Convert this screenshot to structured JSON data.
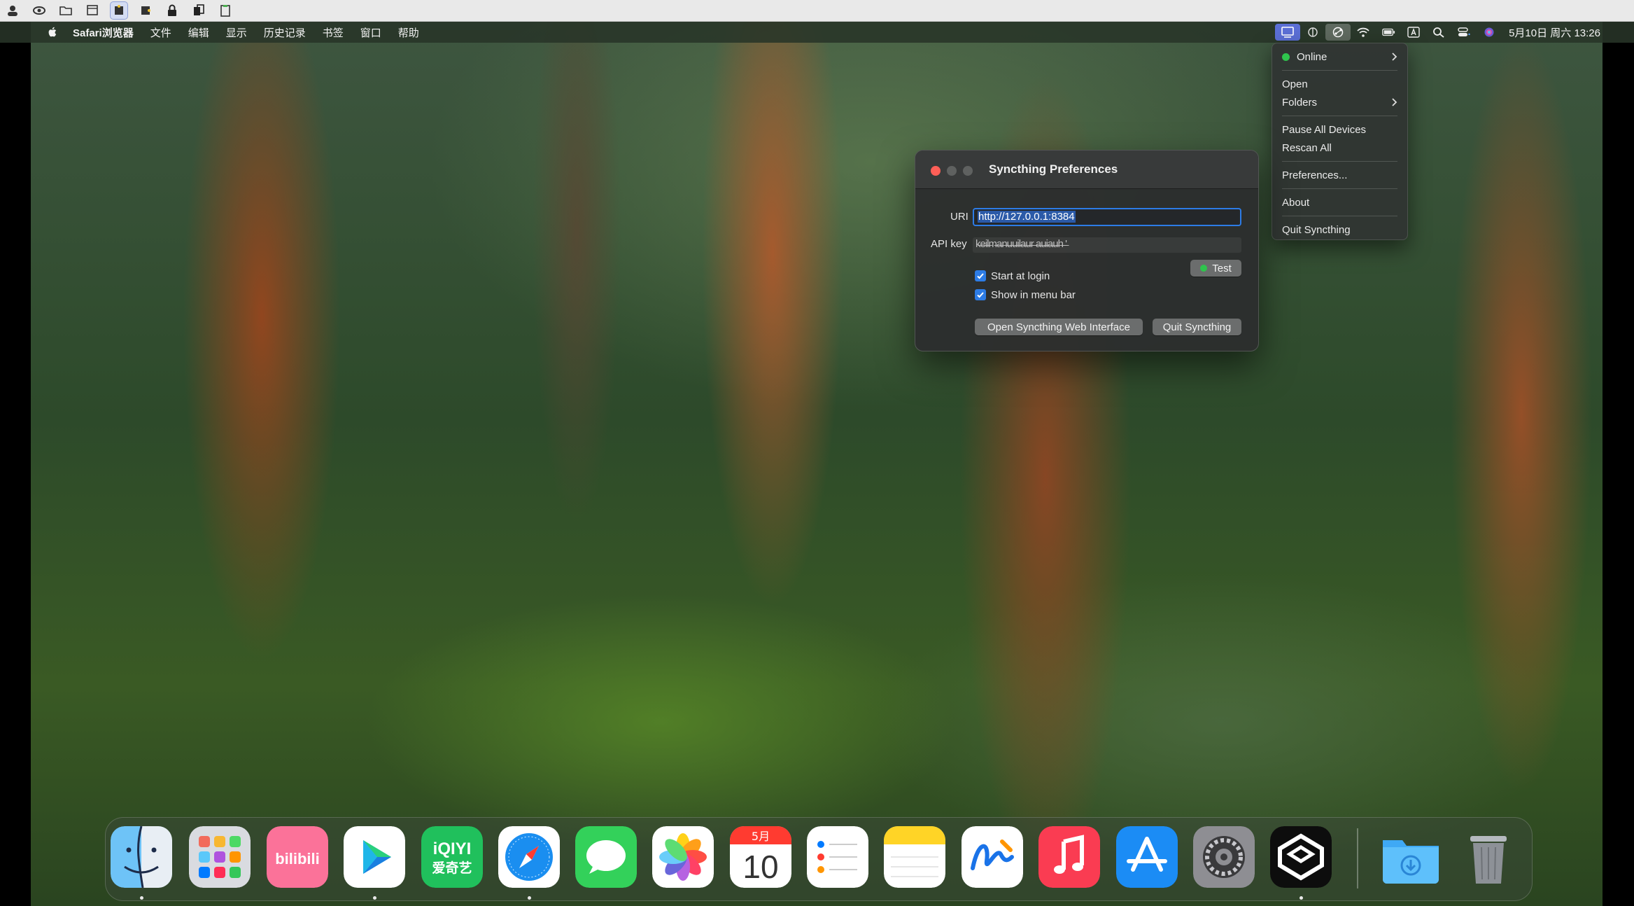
{
  "menubar": {
    "app_name": "Safari浏览器",
    "items": [
      "文件",
      "编辑",
      "显示",
      "历史记录",
      "书签",
      "窗口",
      "帮助"
    ],
    "clock": "5月10日 周六 13:26"
  },
  "dropdown": {
    "status": "Online",
    "open": "Open",
    "folders": "Folders",
    "pause_all": "Pause All Devices",
    "rescan_all": "Rescan All",
    "preferences": "Preferences...",
    "about": "About",
    "quit": "Quit Syncthing"
  },
  "prefs": {
    "title": "Syncthing Preferences",
    "uri_label": "URI",
    "uri_value": "http://127.0.0.1:8384",
    "api_label": "API key",
    "api_value": "k̶e̶i̶l̶m̶a̶n̶u̶u̶i̶l̶a̶u̶r̶ ̶a̶u̶i̶a̶u̶h̶ ̶'",
    "test_label": "Test",
    "start_at_login": "Start at login",
    "show_in_menu_bar": "Show in menu bar",
    "open_web_ui": "Open Syncthing Web Interface",
    "quit_button": "Quit Syncthing",
    "start_at_login_checked": true,
    "show_in_menu_bar_checked": true
  },
  "dock": {
    "calendar_month": "5月",
    "calendar_day": "10",
    "iqiyi_line1": "iQIYI",
    "iqiyi_line2": "爱奇艺",
    "bilibili_text": "bilibili"
  },
  "colors": {
    "accent": "#2d7ce6",
    "online": "#2fc44d",
    "close": "#fe5f57"
  }
}
